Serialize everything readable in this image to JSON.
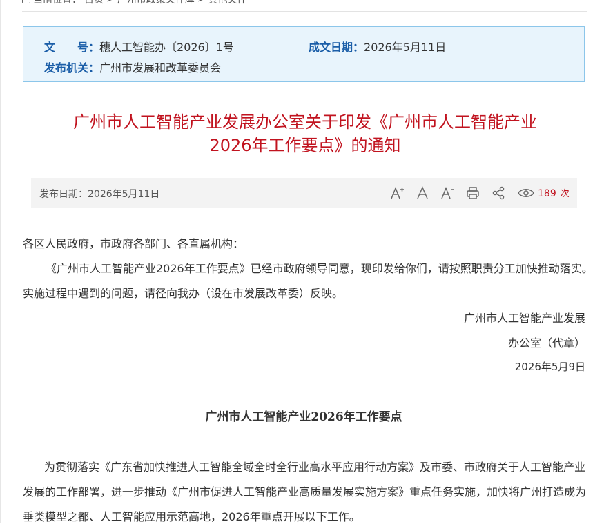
{
  "breadcrumb": {
    "prefix": "当前位置：",
    "items": [
      "首页",
      "广州市政策文件库",
      "其他文件"
    ],
    "separator": ">"
  },
  "meta": {
    "doc_number_label": "文　　号：",
    "doc_number_value": "穗人工智能办〔2026〕1号",
    "written_date_label": "成文日期：",
    "written_date_value": "2026年5月11日",
    "issuer_label": "发布机关：",
    "issuer_value": "广州市发展和改革委员会"
  },
  "title": {
    "line1": "广州市人工智能产业发展办公室关于印发《广州市人工智能产业",
    "line2": "2026年工作要点》的通知"
  },
  "toolbar": {
    "publish_date": "发布日期：2026年5月11日",
    "icons": [
      "font-increase-icon",
      "font-reset-icon",
      "font-decrease-icon",
      "print-icon",
      "share-icon",
      "view-eye-icon"
    ],
    "views_count": "189",
    "views_unit": "次"
  },
  "body": {
    "salutation": "各区人民政府，市政府各部门、各直属机构：",
    "para1_line1": "《广州市人工智能产业2026年工作要点》已经市政府领导同意，现印发给你们，请按照职责分工加快推动落实。",
    "para1_line2": "实施过程中遇到的问题，请径向我办（设在市发展改革委）反映。",
    "sign_line1": "广州市人工智能产业发展",
    "sign_line2": "办公室（代章）",
    "sign_date": "2026年5月9日",
    "section_title": "广州市人工智能产业2026年工作要点",
    "para2_line1": "为贯彻落实《广东省加快推进人工智能全域全时全行业高水平应用行动方案》及市委、市政府关于人工智能产业",
    "para2_line2": "发展的工作部署，进一步推动《广州市促进人工智能产业高质量发展实施方案》重点任务实施，加快将广州打造成为",
    "para2_line3": "垂类模型之都、人工智能应用示范高地，2026年重点开展以下工作。"
  },
  "colors": {
    "title_red": "#c1131f",
    "label_blue": "#1b5ea8",
    "meta_bg": "#e8f4fc",
    "meta_border": "#8cc6ea"
  }
}
